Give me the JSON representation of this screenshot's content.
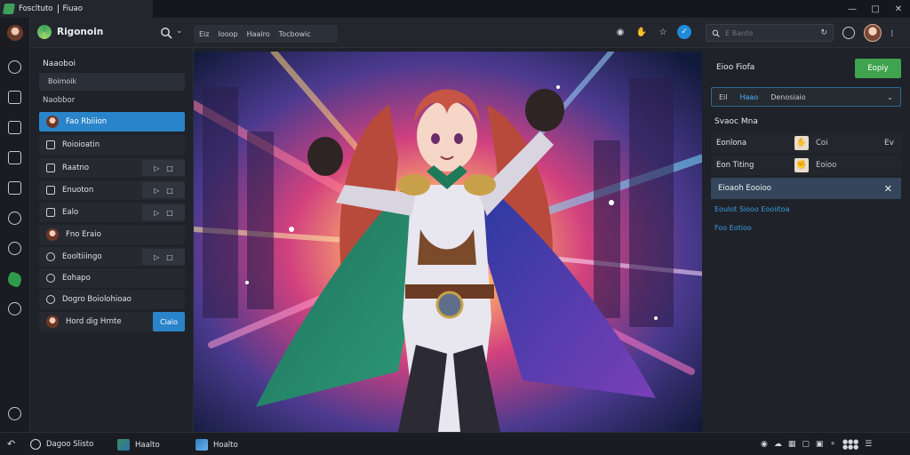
{
  "app": {
    "title_left": "Foscltuto",
    "title_right": "Fiuao"
  },
  "toolbar": {
    "project_name": "Rigonoin",
    "breadcrumb": [
      "Eiz",
      "Iooop",
      "Haalro",
      "Tocbowic"
    ],
    "search_placeholder": "E Banto",
    "search_value": ""
  },
  "left_panel": {
    "heading": "Naaoboi",
    "input_value": "Boimoik",
    "subheading": "Naobbor",
    "items": [
      {
        "label": "Fao Rbiiion",
        "lead": "thumb",
        "selected": true
      },
      {
        "label": "Roioioatin",
        "lead": "square"
      },
      {
        "label": "Raatno",
        "lead": "square",
        "actions": true
      },
      {
        "label": "Enuoton",
        "lead": "square",
        "actions": true
      },
      {
        "label": "Ealo",
        "lead": "square",
        "actions": true
      },
      {
        "label": "Fno Eraio",
        "lead": "thumb"
      },
      {
        "label": "Eooltiiingo",
        "lead": "circle",
        "actions": true
      },
      {
        "label": "Eohapo",
        "lead": "circle"
      },
      {
        "label": "Dogro Boiolohioao",
        "lead": "circle"
      },
      {
        "label": "Hord dig Hrnte",
        "lead": "thumb",
        "button": "Cialo"
      }
    ]
  },
  "right_panel": {
    "title": "Eioo Fiofa",
    "primary_button": "Eopiy",
    "select": {
      "prefix": "Eil",
      "active": "Haao",
      "rest": "Denosiaio"
    },
    "section": "Svaoc Mna",
    "rows": [
      {
        "key": "Eonlona",
        "value": "Coi",
        "end": "Ev"
      },
      {
        "key": "Eon Titing",
        "value": "Eoioo",
        "end": ""
      }
    ],
    "highlight": "Eioaoh Eooioo",
    "links": [
      "Eoulot Siooo Eooiitoa",
      "Foo Eotioo"
    ]
  },
  "status_bar": {
    "item1": "Dagoo Slisto",
    "item2": "Haalto",
    "item3": "Hoalto"
  },
  "colors": {
    "accent": "#2a84c9",
    "primary_green": "#3fa34f",
    "background": "#1e2128"
  }
}
